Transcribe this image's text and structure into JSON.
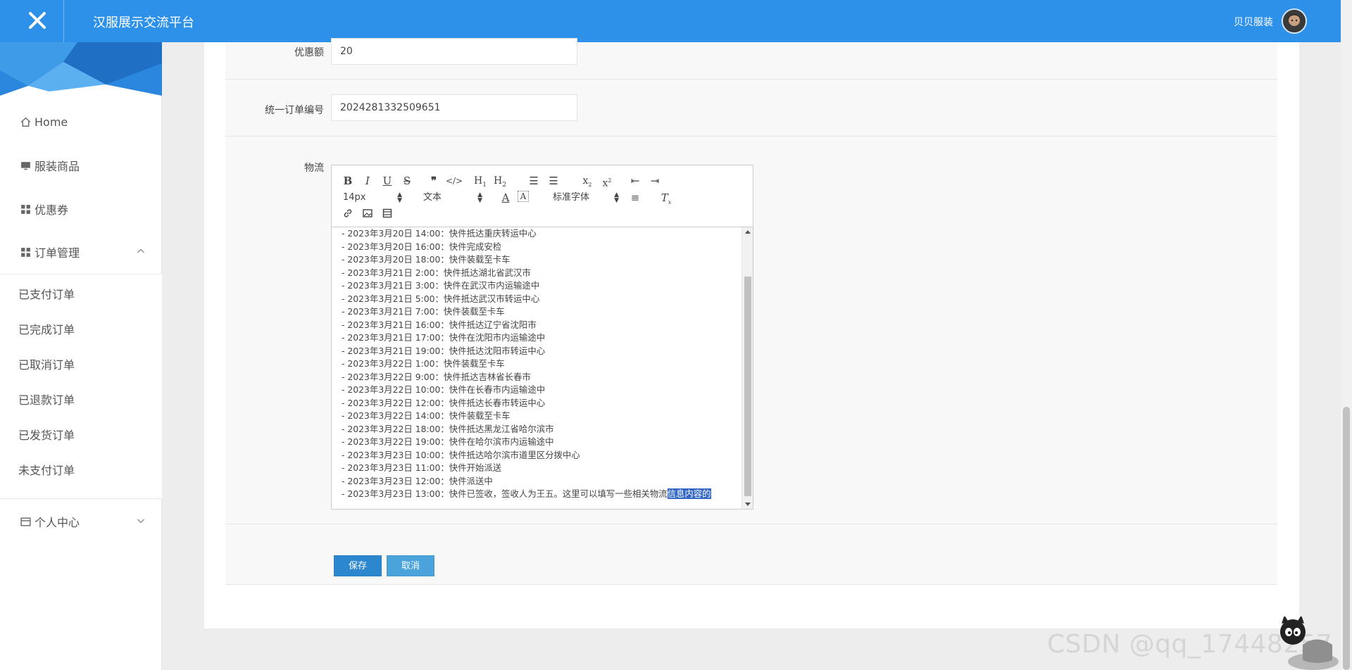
{
  "header": {
    "title": "汉服展示交流平台",
    "user_name": "贝贝服装"
  },
  "sidebar": {
    "items": [
      {
        "label": "Home",
        "icon": "home-icon"
      },
      {
        "label": "服装商品",
        "icon": "monitor-icon"
      },
      {
        "label": "优惠券",
        "icon": "grid-icon"
      },
      {
        "label": "订单管理",
        "icon": "grid-icon",
        "expanded": true
      },
      {
        "label": "个人中心",
        "icon": "card-icon",
        "expanded": false
      }
    ],
    "order_submenu": [
      "已支付订单",
      "已完成订单",
      "已取消订单",
      "已退款订单",
      "已发货订单",
      "未支付订单"
    ]
  },
  "form": {
    "discount_label": "优惠额",
    "discount_value": "20",
    "order_no_label": "统一订单编号",
    "order_no_value": "2024281332509651",
    "logistics_label": "物流"
  },
  "editor": {
    "font_size": "14px",
    "block_type": "文本",
    "font_family": "标准字体",
    "lines": [
      "- 2023年3月20日 14:00：快件抵达重庆转运中心",
      "- 2023年3月20日 16:00：快件完成安检",
      "- 2023年3月20日 18:00：快件装载至卡车",
      "- 2023年3月21日 2:00：快件抵达湖北省武汉市",
      "- 2023年3月21日 3:00：快件在武汉市内运输途中",
      "- 2023年3月21日 5:00：快件抵达武汉市转运中心",
      "- 2023年3月21日 7:00：快件装载至卡车",
      "- 2023年3月21日 16:00：快件抵达辽宁省沈阳市",
      "- 2023年3月21日 17:00：快件在沈阳市内运输途中",
      "- 2023年3月21日 19:00：快件抵达沈阳市转运中心",
      "- 2023年3月22日 1:00：快件装载至卡车",
      "- 2023年3月22日 9:00：快件抵达吉林省长春市",
      "- 2023年3月22日 10:00：快件在长春市内运输途中",
      "- 2023年3月22日 12:00：快件抵达长春市转运中心",
      "- 2023年3月22日 14:00：快件装载至卡车",
      "- 2023年3月22日 18:00：快件抵达黑龙江省哈尔滨市",
      "- 2023年3月22日 19:00：快件在哈尔滨市内运输途中",
      "- 2023年3月23日 10:00：快件抵达哈尔滨市道里区分拨中心",
      "- 2023年3月23日 11:00：快件开始派送",
      "- 2023年3月23日 12:00：快件派送中"
    ],
    "last_line_plain": "- 2023年3月23日 13:00：快件已签收，签收人为王五。这里可以填写一些相关物流",
    "last_line_selected": "信息内容的"
  },
  "buttons": {
    "save": "保存",
    "cancel": "取消"
  },
  "watermark": "CSDN @qq_17448257",
  "colors": {
    "header": "#2d91ea",
    "save_button": "#2d87ce",
    "cancel_button": "#4ba3dc",
    "selection": "#3166c4"
  }
}
